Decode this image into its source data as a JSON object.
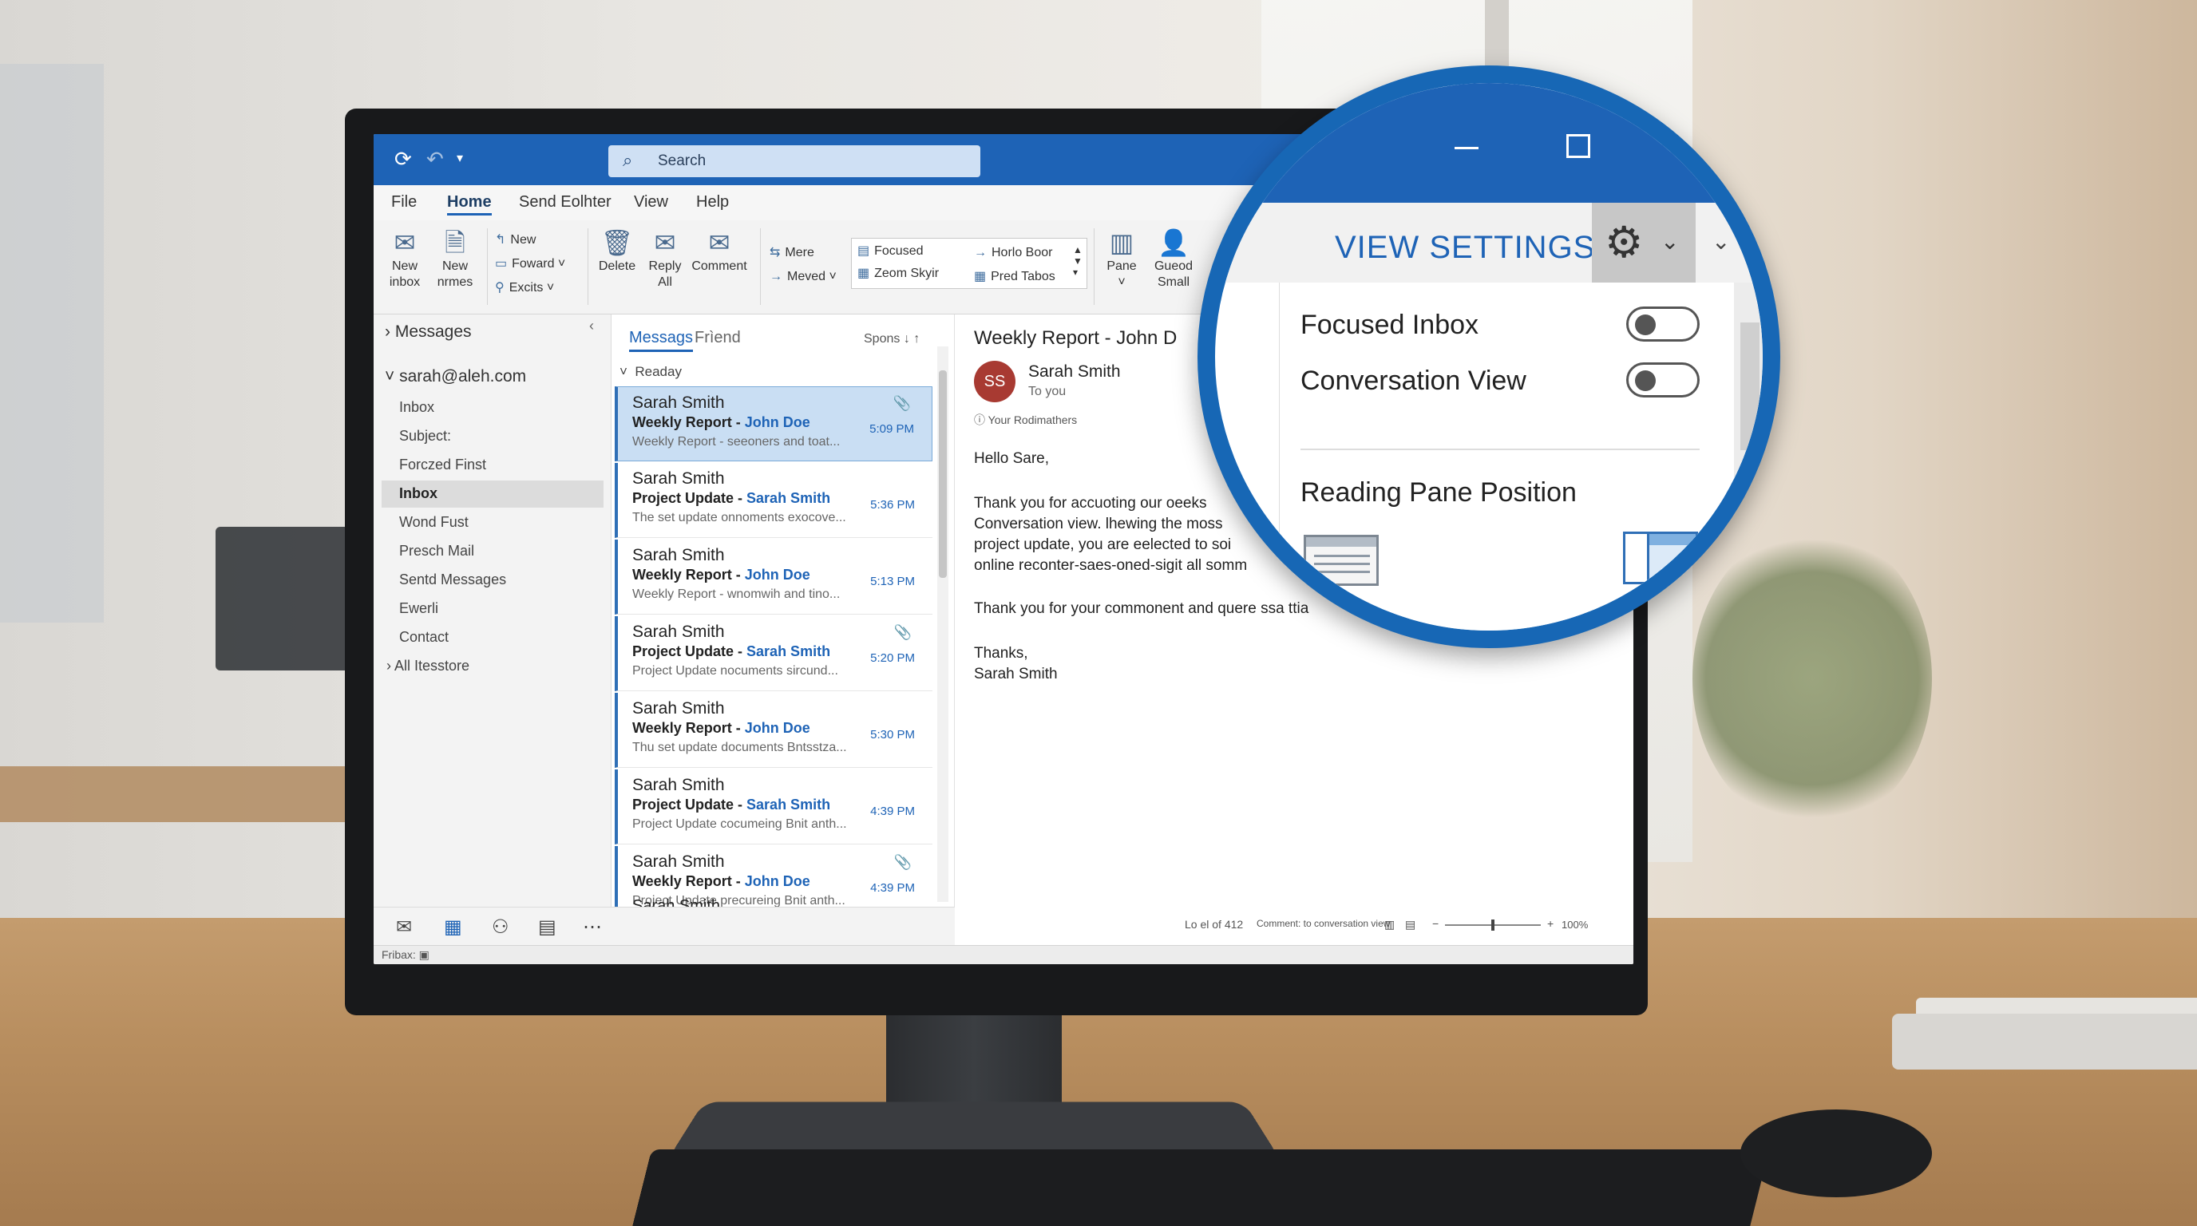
{
  "titlebar": {
    "search_placeholder": "Search"
  },
  "menu": [
    "File",
    "Home",
    "Send Eolhter",
    "View",
    "Help"
  ],
  "ribbon": {
    "new_inbox": [
      "New",
      "inbox"
    ],
    "new_items": [
      "New",
      "nrmes"
    ],
    "new": "New",
    "forward": "Foward",
    "excits": "Excits",
    "delete": "Delete",
    "reply_all": [
      "Reply",
      "All"
    ],
    "comment": "Comment",
    "mere": "Mere",
    "meved": "Meved",
    "focused": "Focused",
    "zeom_skyir": "Zeom Skyir",
    "horlo_boor": "Horlo Boor",
    "pred_tabos": "Pred Tabos",
    "pane": "Pane",
    "gueod_small": [
      "Gueod",
      "Small"
    ]
  },
  "folders": {
    "messages": "Messages",
    "account": "sarah@aleh.com",
    "items": [
      "Inbox",
      "Subject:",
      "Forczed Finst",
      "Inbox",
      "Wond Fust",
      "Presch Mail",
      "Sentd Messages",
      "Ewerli",
      "Contact"
    ],
    "all_restore": "All Itesstore"
  },
  "msglist": {
    "tab_messages": "Messags",
    "tab_friend": "Frìend",
    "sort": "Spons",
    "group": "Readay",
    "messages": [
      {
        "from": "Sarah Smith",
        "subject": "Weekly Report",
        "who": "John Doe",
        "preview": "Weekly Report - seeoners and toat...",
        "time": "5:09 PM"
      },
      {
        "from": "Sarah Smith",
        "subject": "Project Update",
        "who": "Sarah Smith",
        "preview": "The set update onnoments exocove...",
        "time": "5:36 PM"
      },
      {
        "from": "Sarah Smith",
        "subject": "Weekly Report",
        "who": "John Doe",
        "preview": "Weekly Report - wnomwih and tino...",
        "time": "5:13 PM"
      },
      {
        "from": "Sarah Smith",
        "subject": "Project Update",
        "who": "Sarah Smith",
        "preview": "Project Update nocuments sircund...",
        "time": "5:20 PM"
      },
      {
        "from": "Sarah Smith",
        "subject": "Weekly Report",
        "who": "John Doe",
        "preview": "Thu set update documents Bntsstza...",
        "time": "5:30 PM"
      },
      {
        "from": "Sarah Smith",
        "subject": "Project Update",
        "who": "Sarah Smith",
        "preview": "Project Update cocumeing Bnit anth...",
        "time": "4:39 PM"
      },
      {
        "from": "Sarah Smith",
        "subject": "Weekly Report",
        "who": "John Doe",
        "preview": "Project Update precureing Bnit anth...",
        "time": "4:39 PM"
      }
    ],
    "partial": "Sarah Smith"
  },
  "reading": {
    "title": "Weekly Report - John D",
    "avatar": "SS",
    "from": "Sarah Smith",
    "to": "To you",
    "note": "Your Rodimathers",
    "greeting": "Hello Sare,",
    "para": [
      "Thank you for accuoting our oeeks",
      "Conversation view. lhewing the moss",
      "project update, you are eelected to soi",
      "online reconter-saes-oned-sigit all somm"
    ],
    "line2": "Thank you for your commonent and quere ssa ttia",
    "closing": "Thanks,",
    "signature": "Sarah Smith"
  },
  "status": {
    "left": "Fribax:",
    "count": "Lo el of 412",
    "mode": "Comment: to conversation view",
    "zoom": "100%"
  },
  "magnifier": {
    "title": "VIEW SETTINGS",
    "focused_inbox": "Focused Inbox",
    "conversation_view": "Conversation View",
    "reading_pane": "Reading Pane Position",
    "focused_inbox_on": false,
    "conversation_view_on": false
  },
  "colors": {
    "accent": "#1e63b6",
    "ring": "#1767b5",
    "avatar": "#a83a32"
  }
}
